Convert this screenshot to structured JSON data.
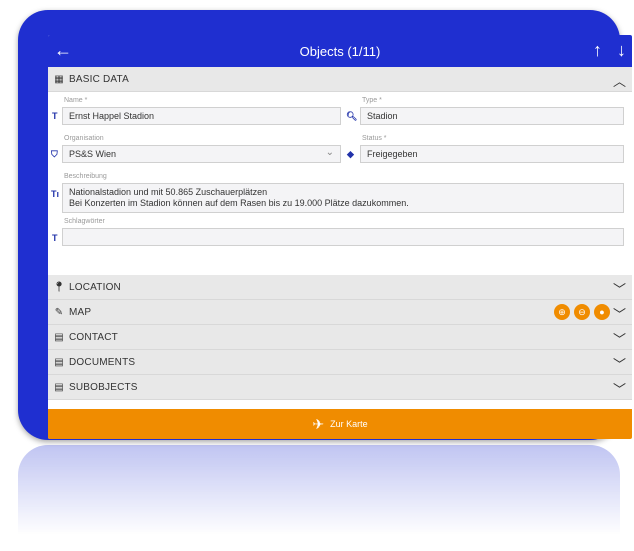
{
  "titlebar": {
    "title": "Objects (1/11)",
    "back_icon": "arrow-left-icon",
    "up_icon": "arrow-up-icon",
    "down_icon": "arrow-down-icon"
  },
  "sections": {
    "basic": {
      "label": "BASIC DATA",
      "icon": "table-icon"
    },
    "location": {
      "label": "LOCATION",
      "icon": "pin-icon"
    },
    "map": {
      "label": "MAP",
      "icon": "pen-icon"
    },
    "contact": {
      "label": "CONTACT",
      "icon": "list-icon"
    },
    "documents": {
      "label": "DOCUMENTS",
      "icon": "list-icon"
    },
    "subobjects": {
      "label": "SUBOBJECTS",
      "icon": "list-icon"
    }
  },
  "form": {
    "name_label": "Name *",
    "name_value": "Ernst Happel Stadion",
    "type_label": "Type *",
    "type_value": "Stadion",
    "org_label": "Organisation",
    "org_value": "PS&S Wien",
    "status_label": "Status *",
    "status_value": "Freigegeben",
    "desc_label": "Beschreibung",
    "desc_line1": "Nationalstadion und mit 50.865 Zuschauerplätzen",
    "desc_line2": "Bei Konzerten im Stadion können auf dem Rasen bis zu 19.000 Plätze dazukommen.",
    "keywords_label": "Schlagwörter",
    "keywords_value": ""
  },
  "map_buttons": [
    "zoom-in-icon",
    "zoom-out-icon",
    "locate-icon"
  ],
  "bottombar": {
    "label": "Zur Karte",
    "icon": "map-icon"
  },
  "colors": {
    "primary": "#1f2fd0",
    "accent": "#f08c00",
    "section": "#e8e8e8"
  }
}
